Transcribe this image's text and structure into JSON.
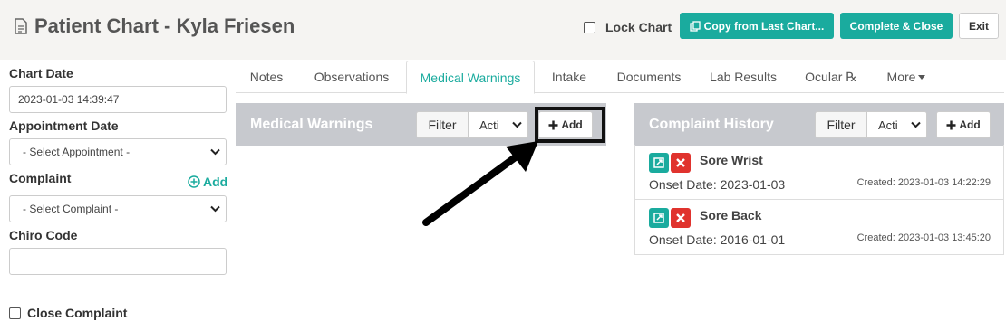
{
  "header": {
    "title": "Patient Chart - Kyla Friesen",
    "lock_label": "Lock Chart",
    "lock_checked": false,
    "copy_label": "Copy from Last Chart...",
    "complete_label": "Complete & Close",
    "exit_label": "Exit"
  },
  "form": {
    "chart_date_label": "Chart Date",
    "chart_date_value": "2023-01-03 14:39:47",
    "appointment_label": "Appointment Date",
    "appointment_value": "- Select Appointment -",
    "complaint_label": "Complaint",
    "complaint_add": "Add",
    "complaint_value": "- Select Complaint -",
    "chiro_label": "Chiro Code",
    "chiro_value": "",
    "close_label": "Close Complaint",
    "close_checked": false
  },
  "tabs": [
    "Notes",
    "Observations",
    "Medical Warnings",
    "Intake",
    "Documents",
    "Lab Results",
    "Ocular ℞",
    "More"
  ],
  "active_tab": "Medical Warnings",
  "medical_warnings": {
    "title": "Medical Warnings",
    "filter_label": "Filter",
    "filter_value": "Acti",
    "add_label": "Add"
  },
  "complaint_history": {
    "title": "Complaint History",
    "filter_label": "Filter",
    "filter_value": "Acti",
    "add_label": "Add",
    "items": [
      {
        "name": "Sore Wrist",
        "onset": "Onset Date: 2023-01-03",
        "created": "Created: 2023-01-03 14:22:29"
      },
      {
        "name": "Sore Back",
        "onset": "Onset Date: 2016-01-01",
        "created": "Created: 2023-01-03 13:45:20"
      }
    ]
  },
  "colors": {
    "accent": "#1aab9e",
    "danger": "#e0332e",
    "panel_header": "#c7c9ce",
    "header_bg": "#f5f4f2"
  }
}
